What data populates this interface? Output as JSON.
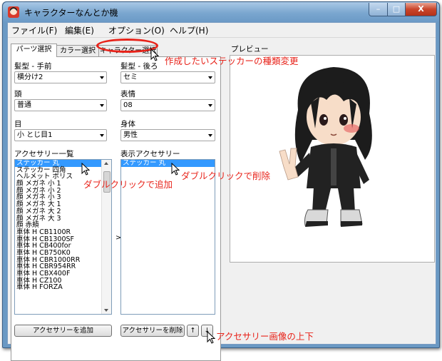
{
  "window": {
    "title": "キャラクターなんとか機",
    "minimize": "–",
    "maximize": "□",
    "close": "X"
  },
  "menu": [
    "ファイル(F)",
    "編集(E)",
    "オプション(O)",
    "ヘルプ(H)"
  ],
  "tabs": [
    "パーツ選択",
    "カラー選択",
    "キャラクター選択"
  ],
  "fields": {
    "hair_front": {
      "label": "髪型 - 手前",
      "value": "横分け2"
    },
    "hair_back": {
      "label": "髪型 - 後ろ",
      "value": "セミ"
    },
    "head": {
      "label": "頭",
      "value": "普通"
    },
    "expression": {
      "label": "表情",
      "value": "08"
    },
    "eyes": {
      "label": "目",
      "value": "小 とじ目1"
    },
    "body": {
      "label": "身体",
      "value": "男性"
    }
  },
  "accessory_list": {
    "label": "アクセサリー一覧",
    "items": [
      "ステッカー 丸",
      "ステッカー 四角",
      "ヘルメット ポリス",
      "顔 メガネ 小 1",
      "顔 メガネ 小 2",
      "顔 メガネ 小 3",
      "顔 メガネ 大 1",
      "顔 メガネ 大 2",
      "顔 メガネ 大 3",
      "顔 赤頬",
      "車体 H CB1100R",
      "車体 H CB1300SF",
      "車体 H CB400for",
      "車体 H CB750K0",
      "車体 H CBR1000RR",
      "車体 H CBR954RR",
      "車体 H CBX400F",
      "車体 H CZ100",
      "車体 H FORZA"
    ],
    "selected_index": 0
  },
  "display_accessories": {
    "label": "表示アクセサリー",
    "items": [
      "ステッカー 丸"
    ],
    "selected_index": 0
  },
  "move_arrow": ">",
  "buttons": {
    "add": "アクセサリーを追加",
    "remove": "アクセサリーを削除",
    "up": "↑",
    "down": "↓"
  },
  "preview": {
    "label": "プレビュー"
  },
  "annotations": {
    "sticker_type": "作成したいステッカーの種類変更",
    "double_click_add": "ダブルクリックで追加",
    "double_click_remove": "ダブルクリックで削除",
    "reorder": "アクセサリー画像の上下"
  },
  "colors": {
    "annotation": "#e8231a",
    "selection": "#3399ff",
    "titlebar": "#7aa6cf"
  }
}
